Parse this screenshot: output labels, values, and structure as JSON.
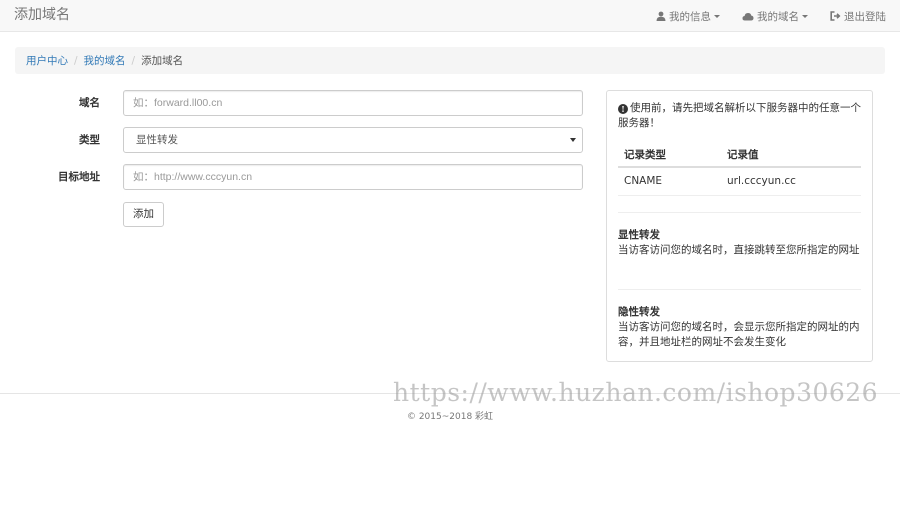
{
  "navbar": {
    "brand": "添加域名",
    "items": [
      {
        "icon": "user-icon",
        "label": "我的信息"
      },
      {
        "icon": "cloud-icon",
        "label": "我的域名"
      },
      {
        "icon": "logout-icon",
        "label": "退出登陆"
      }
    ]
  },
  "breadcrumb": {
    "items": [
      "用户中心",
      "我的域名"
    ],
    "active": "添加域名"
  },
  "form": {
    "domain_label": "域名",
    "domain_placeholder": "如：forward.ll00.cn",
    "type_label": "类型",
    "type_value": "显性转发",
    "target_label": "目标地址",
    "target_placeholder": "如：http://www.cccyun.cn",
    "submit_label": "添加"
  },
  "panel": {
    "tip": "使用前，请先把域名解析以下服务器中的任意一个服务器！",
    "table": {
      "headers": [
        "记录类型",
        "记录值"
      ],
      "rows": [
        [
          "CNAME",
          "url.cccyun.cc"
        ]
      ]
    },
    "explicit_title": "显性转发",
    "explicit_desc": "当访客访问您的域名时，直接跳转至您所指定的网址",
    "implicit_title": "隐性转发",
    "implicit_desc": "当访客访问您的域名时，会显示您所指定的网址的内容，并且地址栏的网址不会发生变化"
  },
  "footer": {
    "copyright": "© 2015~2018 彩虹"
  },
  "watermark": "https://www.huzhan.com/ishop30626"
}
